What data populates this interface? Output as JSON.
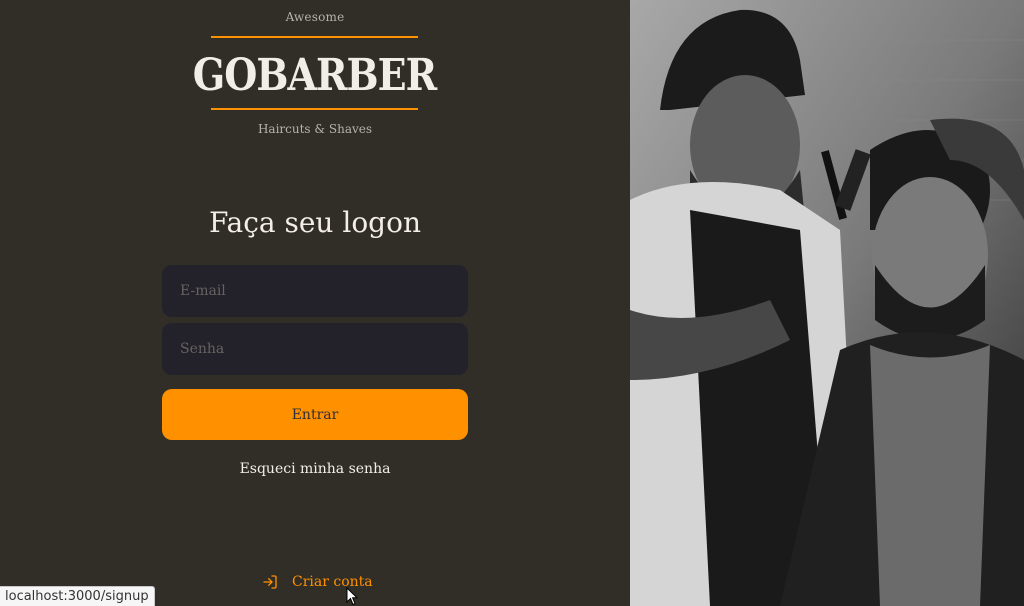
{
  "logo": {
    "top_text": "Awesome",
    "wordmark": "GOBARBER",
    "bottom_text": "Haircuts & Shaves"
  },
  "form": {
    "title": "Faça seu logon",
    "email_placeholder": "E-mail",
    "password_placeholder": "Senha",
    "submit_label": "Entrar",
    "forgot_label": "Esqueci minha senha"
  },
  "signup": {
    "label": "Criar conta",
    "icon": "log-in-icon"
  },
  "status_bar": {
    "url": "localhost:3000/signup"
  },
  "colors": {
    "background": "#312e28",
    "accent": "#ff9000",
    "input_bg": "#232129",
    "text": "#f4ede8"
  }
}
